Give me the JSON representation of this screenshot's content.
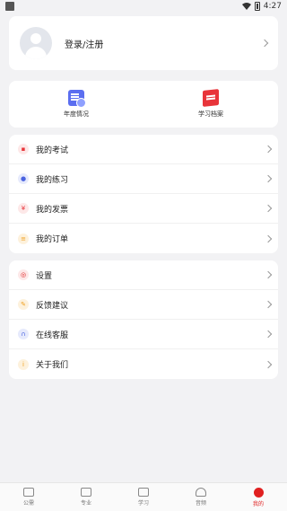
{
  "status_bar": {
    "time": "4:27"
  },
  "profile": {
    "login_label": "登录/注册"
  },
  "quick_links": [
    {
      "label": "年度情况",
      "icon": "calendar-check-icon",
      "color": "#5b6ef0"
    },
    {
      "label": "学习档案",
      "icon": "archive-file-icon",
      "color": "#e8343a"
    }
  ],
  "menu_group_1": [
    {
      "label": "我的考试",
      "icon": "exam-icon",
      "glyph": "▪",
      "color": "#e8343a"
    },
    {
      "label": "我的练习",
      "icon": "practice-icon",
      "glyph": "●",
      "color": "#4a63e0"
    },
    {
      "label": "我的发票",
      "icon": "invoice-icon",
      "glyph": "¥",
      "color": "#e8343a"
    },
    {
      "label": "我的订单",
      "icon": "order-icon",
      "glyph": "≡",
      "color": "#f0a020"
    }
  ],
  "menu_group_2": [
    {
      "label": "设置",
      "icon": "settings-icon",
      "glyph": "◎",
      "color": "#e02020"
    },
    {
      "label": "反馈建议",
      "icon": "feedback-icon",
      "glyph": "✎",
      "color": "#f0a020"
    },
    {
      "label": "在线客服",
      "icon": "headset-icon",
      "glyph": "∩",
      "color": "#4a63e0"
    },
    {
      "label": "关于我们",
      "icon": "info-icon",
      "glyph": "i",
      "color": "#f0a020"
    }
  ],
  "tabbar": [
    {
      "label": "公需",
      "active": false
    },
    {
      "label": "专业",
      "active": false
    },
    {
      "label": "学习",
      "active": false
    },
    {
      "label": "音频",
      "active": false
    },
    {
      "label": "我的",
      "active": true
    }
  ],
  "colors": {
    "accent": "#e02020",
    "background": "#f2f2f4"
  }
}
